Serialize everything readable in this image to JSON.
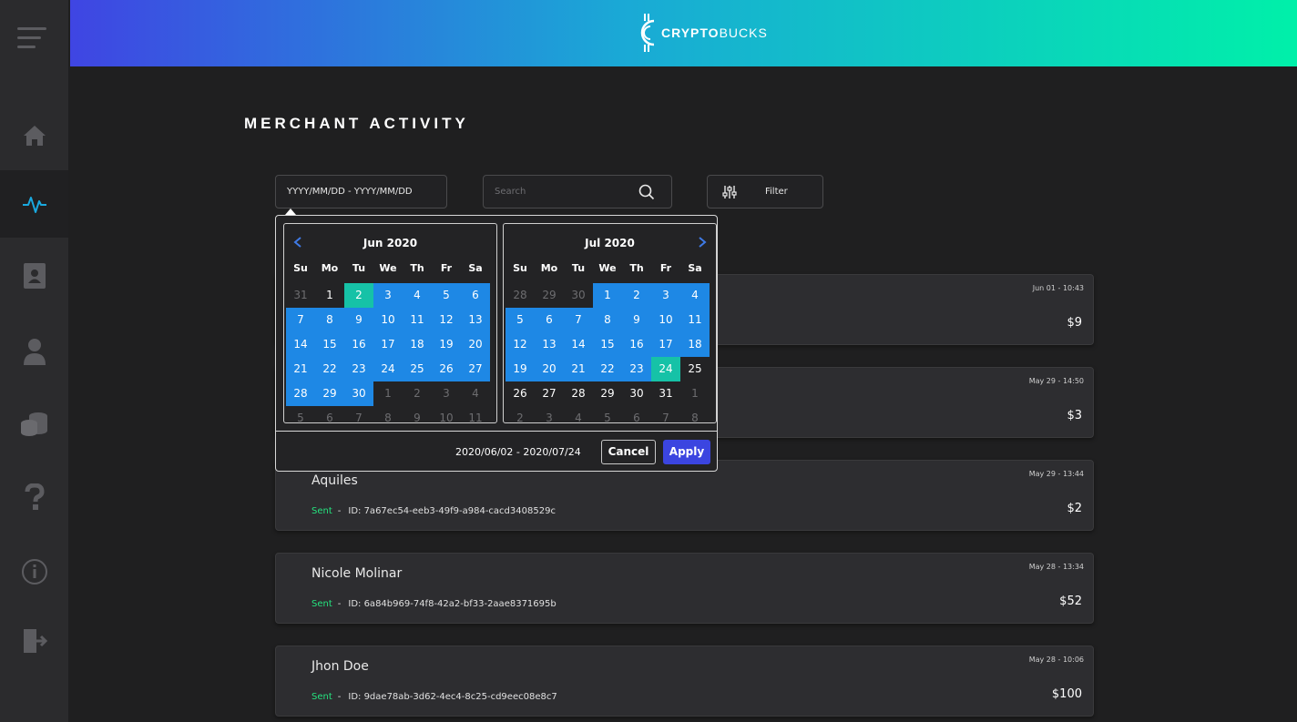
{
  "brand": {
    "logo_text_bold": "CRYPTO",
    "logo_text_rest": "BUCKS",
    "logo_icon": "c-coin-icon"
  },
  "sidebar": {
    "menu_icon": "hamburger-icon",
    "items": [
      {
        "icon": "home-icon",
        "active": false
      },
      {
        "icon": "activity-pulse-icon",
        "active": true
      },
      {
        "icon": "contact-book-icon",
        "active": false
      },
      {
        "icon": "user-icon",
        "active": false
      },
      {
        "icon": "coins-stack-icon",
        "active": false
      },
      {
        "icon": "help-question-icon",
        "active": false
      },
      {
        "icon": "info-icon",
        "active": false
      },
      {
        "icon": "logout-icon",
        "active": false
      }
    ]
  },
  "page": {
    "title": "MERCHANT ACTIVITY"
  },
  "toolbar": {
    "date_placeholder": "YYYY/MM/DD - YYYY/MM/DD",
    "search_placeholder": "Search",
    "filter_label": "Filter"
  },
  "datepicker": {
    "dow": [
      "Su",
      "Mo",
      "Tu",
      "We",
      "Th",
      "Fr",
      "Sa"
    ],
    "left": {
      "title": "Jun 2020",
      "weeks": [
        [
          {
            "d": "31",
            "s": "off"
          },
          {
            "d": "1",
            "s": ""
          },
          {
            "d": "2",
            "s": "endpoint"
          },
          {
            "d": "3",
            "s": "inrange"
          },
          {
            "d": "4",
            "s": "inrange"
          },
          {
            "d": "5",
            "s": "inrange"
          },
          {
            "d": "6",
            "s": "inrange"
          }
        ],
        [
          {
            "d": "7",
            "s": "inrange"
          },
          {
            "d": "8",
            "s": "inrange"
          },
          {
            "d": "9",
            "s": "inrange"
          },
          {
            "d": "10",
            "s": "inrange"
          },
          {
            "d": "11",
            "s": "inrange"
          },
          {
            "d": "12",
            "s": "inrange"
          },
          {
            "d": "13",
            "s": "inrange"
          }
        ],
        [
          {
            "d": "14",
            "s": "inrange"
          },
          {
            "d": "15",
            "s": "inrange"
          },
          {
            "d": "16",
            "s": "inrange"
          },
          {
            "d": "17",
            "s": "inrange"
          },
          {
            "d": "18",
            "s": "inrange"
          },
          {
            "d": "19",
            "s": "inrange"
          },
          {
            "d": "20",
            "s": "inrange"
          }
        ],
        [
          {
            "d": "21",
            "s": "inrange"
          },
          {
            "d": "22",
            "s": "inrange"
          },
          {
            "d": "23",
            "s": "inrange"
          },
          {
            "d": "24",
            "s": "inrange"
          },
          {
            "d": "25",
            "s": "inrange"
          },
          {
            "d": "26",
            "s": "inrange"
          },
          {
            "d": "27",
            "s": "inrange"
          }
        ],
        [
          {
            "d": "28",
            "s": "inrange"
          },
          {
            "d": "29",
            "s": "inrange"
          },
          {
            "d": "30",
            "s": "inrange"
          },
          {
            "d": "1",
            "s": "off"
          },
          {
            "d": "2",
            "s": "off"
          },
          {
            "d": "3",
            "s": "off"
          },
          {
            "d": "4",
            "s": "off"
          }
        ],
        [
          {
            "d": "5",
            "s": "off"
          },
          {
            "d": "6",
            "s": "off"
          },
          {
            "d": "7",
            "s": "off"
          },
          {
            "d": "8",
            "s": "off"
          },
          {
            "d": "9",
            "s": "off"
          },
          {
            "d": "10",
            "s": "off"
          },
          {
            "d": "11",
            "s": "off"
          }
        ]
      ]
    },
    "right": {
      "title": "Jul 2020",
      "weeks": [
        [
          {
            "d": "28",
            "s": "off"
          },
          {
            "d": "29",
            "s": "off"
          },
          {
            "d": "30",
            "s": "off"
          },
          {
            "d": "1",
            "s": "inrange"
          },
          {
            "d": "2",
            "s": "inrange"
          },
          {
            "d": "3",
            "s": "inrange"
          },
          {
            "d": "4",
            "s": "inrange"
          }
        ],
        [
          {
            "d": "5",
            "s": "inrange"
          },
          {
            "d": "6",
            "s": "inrange"
          },
          {
            "d": "7",
            "s": "inrange"
          },
          {
            "d": "8",
            "s": "inrange"
          },
          {
            "d": "9",
            "s": "inrange"
          },
          {
            "d": "10",
            "s": "inrange"
          },
          {
            "d": "11",
            "s": "inrange"
          }
        ],
        [
          {
            "d": "12",
            "s": "inrange"
          },
          {
            "d": "13",
            "s": "inrange"
          },
          {
            "d": "14",
            "s": "inrange"
          },
          {
            "d": "15",
            "s": "inrange"
          },
          {
            "d": "16",
            "s": "inrange"
          },
          {
            "d": "17",
            "s": "inrange"
          },
          {
            "d": "18",
            "s": "inrange"
          }
        ],
        [
          {
            "d": "19",
            "s": "inrange"
          },
          {
            "d": "20",
            "s": "inrange"
          },
          {
            "d": "21",
            "s": "inrange"
          },
          {
            "d": "22",
            "s": "inrange"
          },
          {
            "d": "23",
            "s": "inrange"
          },
          {
            "d": "24",
            "s": "endpoint"
          },
          {
            "d": "25",
            "s": ""
          }
        ],
        [
          {
            "d": "26",
            "s": ""
          },
          {
            "d": "27",
            "s": ""
          },
          {
            "d": "28",
            "s": ""
          },
          {
            "d": "29",
            "s": ""
          },
          {
            "d": "30",
            "s": ""
          },
          {
            "d": "31",
            "s": ""
          },
          {
            "d": "1",
            "s": "off"
          }
        ],
        [
          {
            "d": "2",
            "s": "off"
          },
          {
            "d": "3",
            "s": "off"
          },
          {
            "d": "4",
            "s": "off"
          },
          {
            "d": "5",
            "s": "off"
          },
          {
            "d": "6",
            "s": "off"
          },
          {
            "d": "7",
            "s": "off"
          },
          {
            "d": "8",
            "s": "off"
          }
        ]
      ]
    },
    "selected_range": "2020/06/02 - 2020/07/24",
    "cancel_label": "Cancel",
    "apply_label": "Apply",
    "colors": {
      "in_range": "#1e88e5",
      "endpoint": "#16c2a7",
      "apply": "#3b45e0"
    }
  },
  "activity": [
    {
      "name": "",
      "status": "",
      "id": "",
      "date": "Jun 01 - 10:43",
      "amount": "$9"
    },
    {
      "name": "",
      "status": "",
      "id": "",
      "date": "May 29 - 14:50",
      "amount": "$3"
    },
    {
      "name": "Aquiles",
      "status": "Sent",
      "id": "ID: 7a67ec54-eeb3-49f9-a984-cacd3408529c",
      "date": "May 29 - 13:44",
      "amount": "$2"
    },
    {
      "name": "Nicole Molinar",
      "status": "Sent",
      "id": "ID: 6a84b969-74f8-42a2-bf33-2aae8371695b",
      "date": "May 28 - 13:34",
      "amount": "$52"
    },
    {
      "name": "Jhon Doe",
      "status": "Sent",
      "id": "ID: 9dae78ab-3d62-4ec4-8c25-cd9eec08e8c7",
      "date": "May 28 - 10:06",
      "amount": "$100"
    }
  ]
}
